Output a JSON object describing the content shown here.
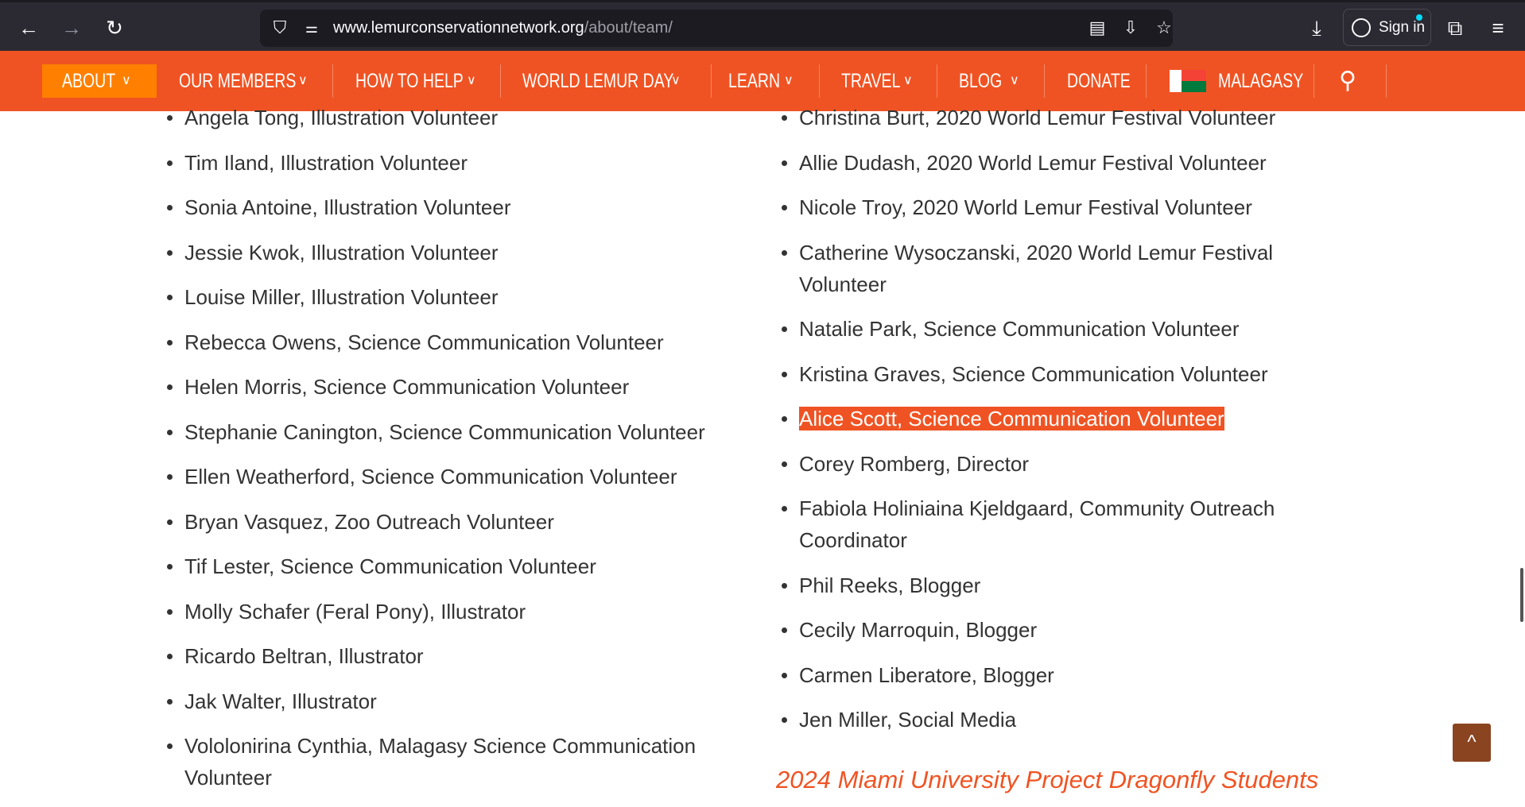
{
  "browser": {
    "url_domain": "www.lemurconservationnetwork.org",
    "url_path": "/about/team/",
    "sign_in": "Sign in"
  },
  "nav": {
    "items": [
      "ABOUT",
      "OUR MEMBERS",
      "HOW TO HELP",
      "WORLD LEMUR DAY",
      "LEARN",
      "TRAVEL",
      "BLOG",
      "DONATE",
      "MALAGASY"
    ],
    "active": "ABOUT",
    "accent": "#f05323"
  },
  "left_list": [
    "Angela Tong, Illustration Volunteer",
    "Tim Iland, Illustration Volunteer",
    "Sonia Antoine, Illustration Volunteer",
    "Jessie Kwok, Illustration Volunteer",
    "Louise Miller, Illustration Volunteer",
    "Rebecca Owens, Science Communication Volunteer",
    "Helen Morris, Science Communication Volunteer",
    "Stephanie Canington, Science Communication Volunteer",
    "Ellen Weatherford, Science Communication Volunteer",
    "Bryan Vasquez, Zoo Outreach Volunteer",
    "Tif Lester, Science Communication Volunteer",
    "Molly Schafer (Feral Pony), Illustrator",
    "Ricardo Beltran, Illustrator",
    "Jak Walter, Illustrator",
    "Vololonirina Cynthia, Malagasy Science Communication Volunteer"
  ],
  "right_list": [
    "Christina Burt, 2020 World Lemur Festival Volunteer",
    "Allie Dudash, 2020 World Lemur Festival Volunteer",
    "Nicole Troy, 2020 World Lemur Festival Volunteer",
    "Catherine Wysoczanski, 2020 World Lemur Festival Volunteer",
    "Natalie Park, Science Communication Volunteer",
    "Kristina Graves, Science Communication Volunteer",
    "Alice Scott, Science Communication Volunteer",
    "Corey Romberg, Director",
    "Fabiola Holiniaina Kjeldgaard, Community Outreach Coordinator",
    "Phil Reeks, Blogger",
    "Cecily Marroquin, Blogger",
    "Carmen Liberatore, Blogger",
    "Jen Miller, Social Media"
  ],
  "highlighted": "Alice Scott, Science Communication Volunteer",
  "section_heading": "2024 Miami University Project Dragonfly Students"
}
